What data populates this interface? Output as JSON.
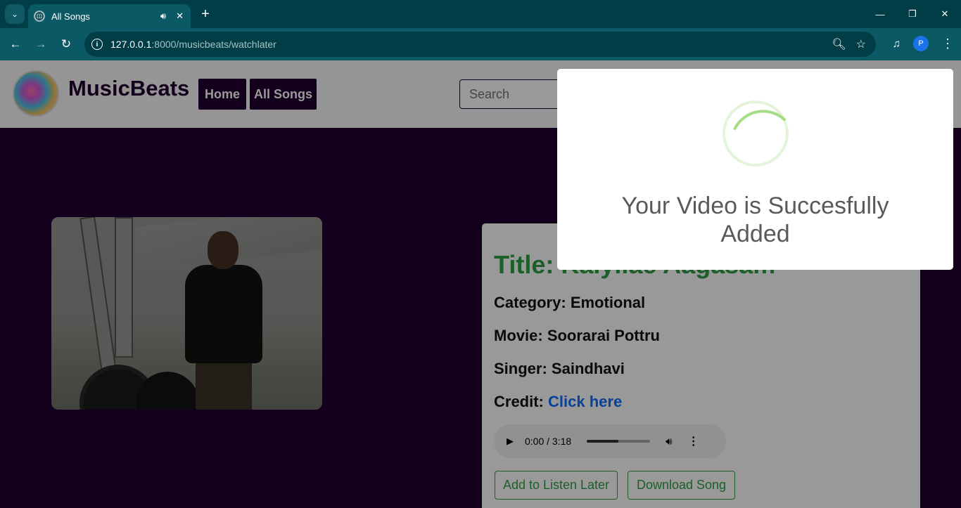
{
  "browser": {
    "tab_title": "All Songs",
    "url_host": "127.0.0.1",
    "url_rest": ":8000/musicbeats/watchlater",
    "profile_initial": "P"
  },
  "site": {
    "brand": "MusicBeats",
    "nav": [
      "Home",
      "All Songs"
    ],
    "search_placeholder": "Search"
  },
  "song": {
    "title_label": "Title:",
    "title_value": "Kaiyilae Aagasam",
    "category_label": "Category:",
    "category_value": "Emotional",
    "movie_label": "Movie:",
    "movie_value": "Soorarai Pottru",
    "singer_label": "Singer:",
    "singer_value": "Saindhavi",
    "credit_label": "Credit:",
    "credit_link": "Click here",
    "audio_time": "0:00 / 3:18",
    "audio_progress": 0.5,
    "listen_later_button": "Add to Listen Later",
    "download_button": "Download Song"
  },
  "popup": {
    "message": "Your Video is Succesfully Added",
    "spinner_color": "#a5dc86"
  },
  "colors": {
    "brand_purple": "#22002f",
    "accent_green": "#2f9e44",
    "link_blue": "#0d6efd"
  }
}
